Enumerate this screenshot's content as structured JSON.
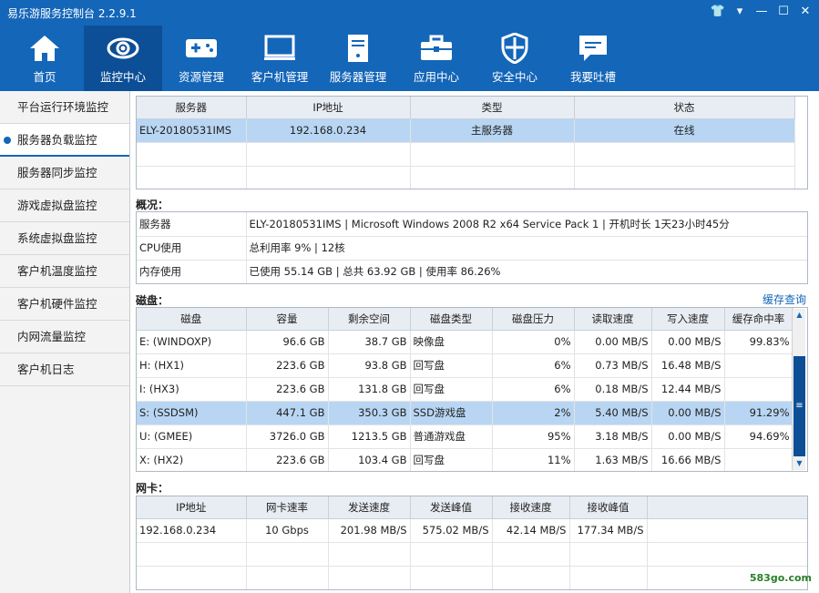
{
  "window": {
    "title": "易乐游服务控制台 2.2.9.1",
    "controls": [
      "👕",
      "▾",
      "—",
      "☐",
      "✕"
    ]
  },
  "nav": [
    {
      "label": "首页",
      "icon": "home-icon"
    },
    {
      "label": "监控中心",
      "icon": "eye-icon",
      "active": true
    },
    {
      "label": "资源管理",
      "icon": "gamepad-icon"
    },
    {
      "label": "客户机管理",
      "icon": "monitor-icon"
    },
    {
      "label": "服务器管理",
      "icon": "server-icon"
    },
    {
      "label": "应用中心",
      "icon": "toolbox-icon"
    },
    {
      "label": "安全中心",
      "icon": "shield-icon"
    },
    {
      "label": "我要吐槽",
      "icon": "chat-icon"
    }
  ],
  "sidebar": [
    {
      "label": "平台运行环境监控"
    },
    {
      "label": "服务器负载监控",
      "active": true
    },
    {
      "label": "服务器同步监控"
    },
    {
      "label": "游戏虚拟盘监控"
    },
    {
      "label": "系统虚拟盘监控"
    },
    {
      "label": "客户机温度监控"
    },
    {
      "label": "客户机硬件监控"
    },
    {
      "label": "内网流量监控"
    },
    {
      "label": "客户机日志"
    }
  ],
  "servers": {
    "columns": [
      "服务器",
      "IP地址",
      "类型",
      "状态"
    ],
    "rows": [
      {
        "name": "ELY-20180531IMS",
        "ip": "192.168.0.234",
        "type": "主服务器",
        "status": "在线"
      }
    ]
  },
  "overview": {
    "title": "概况：",
    "rows": [
      {
        "key": "服务器",
        "value": "ELY-20180531IMS | Microsoft Windows 2008 R2 x64 Service Pack 1 | 开机时长 1天23小时45分"
      },
      {
        "key": "CPU使用",
        "value": "总利用率 9% | 12核"
      },
      {
        "key": "内存使用",
        "value": "已使用 55.14 GB | 总共 63.92 GB | 使用率 86.26%"
      }
    ]
  },
  "disks": {
    "title": "磁盘：",
    "cache_link": "缓存查询",
    "columns": [
      "磁盘",
      "容量",
      "剩余空间",
      "磁盘类型",
      "磁盘压力",
      "读取速度",
      "写入速度",
      "缓存命中率"
    ],
    "rows": [
      {
        "disk": "E: (WINDOXP)",
        "cap": "96.6  GB",
        "free": "38.7  GB",
        "type": "映像盘",
        "load": "0%",
        "read": "0.00  MB/S",
        "write": "0.00  MB/S",
        "hit": "99.83%"
      },
      {
        "disk": "H: (HX1)",
        "cap": "223.6  GB",
        "free": "93.8  GB",
        "type": "回写盘",
        "load": "6%",
        "read": "0.73  MB/S",
        "write": "16.48  MB/S",
        "hit": ""
      },
      {
        "disk": "I: (HX3)",
        "cap": "223.6  GB",
        "free": "131.8  GB",
        "type": "回写盘",
        "load": "6%",
        "read": "0.18  MB/S",
        "write": "12.44  MB/S",
        "hit": ""
      },
      {
        "disk": "S: (SSDSM)",
        "cap": "447.1  GB",
        "free": "350.3  GB",
        "type": "SSD游戏盘",
        "load": "2%",
        "read": "5.40  MB/S",
        "write": "0.00  MB/S",
        "hit": "91.29%",
        "selected": true
      },
      {
        "disk": "U: (GMEE)",
        "cap": "3726.0  GB",
        "free": "1213.5  GB",
        "type": "普通游戏盘",
        "load": "95%",
        "read": "3.18  MB/S",
        "write": "0.00  MB/S",
        "hit": "94.69%"
      },
      {
        "disk": "X: (HX2)",
        "cap": "223.6  GB",
        "free": "103.4  GB",
        "type": "回写盘",
        "load": "11%",
        "read": "1.63  MB/S",
        "write": "16.66  MB/S",
        "hit": ""
      }
    ]
  },
  "nics": {
    "title": "网卡：",
    "columns": [
      "IP地址",
      "网卡速率",
      "发送速度",
      "发送峰值",
      "接收速度",
      "接收峰值"
    ],
    "rows": [
      {
        "ip": "192.168.0.234",
        "rate": "10 Gbps",
        "tx": "201.98  MB/S",
        "txpeak": "575.02  MB/S",
        "rx": "42.14  MB/S",
        "rxpeak": "177.34  MB/S"
      }
    ]
  },
  "watermark": "583go.com"
}
